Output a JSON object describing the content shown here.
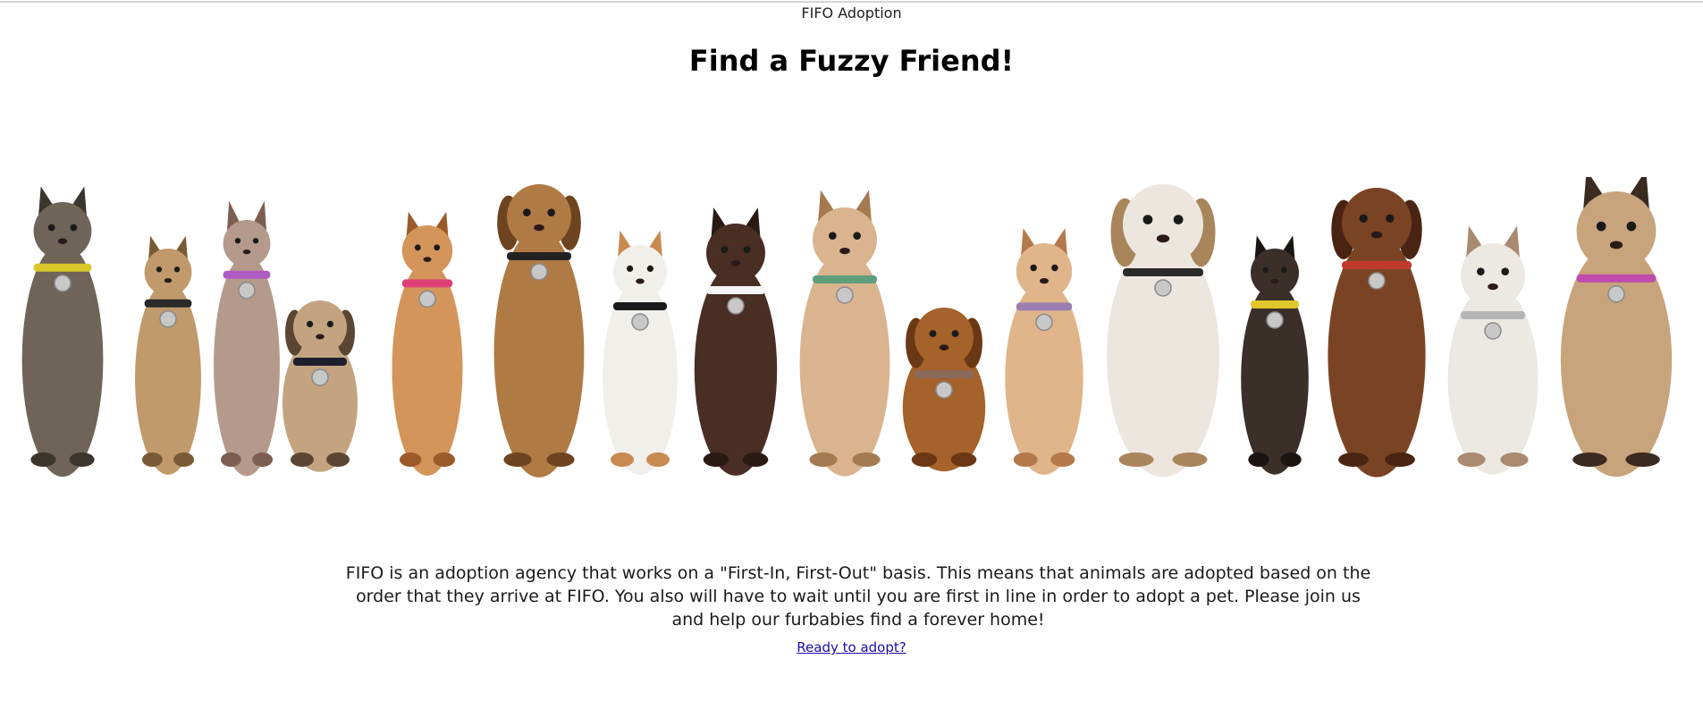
{
  "header": {
    "site_title": "FIFO Adoption",
    "heading": "Find a Fuzzy Friend!"
  },
  "hero": {
    "animals": [
      {
        "name": "maine-coon-cat",
        "body": "#6e6457",
        "dark": "#3b352e",
        "collar": "#d9c92b",
        "ears": "cat"
      },
      {
        "name": "chihuahua-tan",
        "body": "#c09a6b",
        "dark": "#7a5a35",
        "collar": "#2a2a2a",
        "ears": "dog-up"
      },
      {
        "name": "sphynx-cat",
        "body": "#b59a8c",
        "dark": "#7d5f52",
        "collar": "#b05cc4",
        "ears": "cat-big"
      },
      {
        "name": "pug-mix",
        "body": "#c4a480",
        "dark": "#5a4632",
        "collar": "#1e1e2e",
        "ears": "dog-flop"
      },
      {
        "name": "orange-tabby-cat",
        "body": "#d4955a",
        "dark": "#9a5a2a",
        "collar": "#e0407a",
        "ears": "cat"
      },
      {
        "name": "brown-white-dog",
        "body": "#b07a45",
        "dark": "#6e4420",
        "collar": "#222222",
        "ears": "dog-flop"
      },
      {
        "name": "exotic-shorthair-cat",
        "body": "#f0efea",
        "dark": "#c98a50",
        "collar": "#1a1a1a",
        "ears": "cat"
      },
      {
        "name": "black-white-chihuahua",
        "body": "#4a2e24",
        "dark": "#2a1a14",
        "collar": "#f5f5f5",
        "ears": "dog-up"
      },
      {
        "name": "cream-british-cat",
        "body": "#d9b48e",
        "dark": "#a57a50",
        "collar": "#5e9e7a",
        "ears": "cat"
      },
      {
        "name": "cavalier-puppy",
        "body": "#a5622a",
        "dark": "#6a3814",
        "collar": "#8a6a5a",
        "ears": "dog-flop"
      },
      {
        "name": "ginger-kitten",
        "body": "#e0b58a",
        "dark": "#b5784a",
        "collar": "#9a7fb0",
        "ears": "cat"
      },
      {
        "name": "english-bulldog",
        "body": "#ece6de",
        "dark": "#a9855c",
        "collar": "#2a2a2a",
        "ears": "dog-flop"
      },
      {
        "name": "tortoiseshell-kitten",
        "body": "#3b2f2a",
        "dark": "#1a1512",
        "collar": "#e0c82a",
        "ears": "cat"
      },
      {
        "name": "basset-hound",
        "body": "#7a4424",
        "dark": "#4a2412",
        "collar": "#c0392b",
        "ears": "dog-flop"
      },
      {
        "name": "calico-persian-cat",
        "body": "#ece8e2",
        "dark": "#a98a70",
        "collar": "#b5b5b5",
        "ears": "cat"
      },
      {
        "name": "french-bulldog",
        "body": "#c7a47c",
        "dark": "#3a2a20",
        "collar": "#c04ab0",
        "ears": "dog-up"
      }
    ]
  },
  "intro": {
    "text": "FIFO is an adoption agency that works on a \"First-In, First-Out\" basis. This means that animals are adopted based on the order that they arrive at FIFO. You also will have to wait until you are first in line in order to adopt a pet. Please join us and help our furbabies find a forever home!"
  },
  "cta": {
    "label": "Ready to adopt?"
  }
}
